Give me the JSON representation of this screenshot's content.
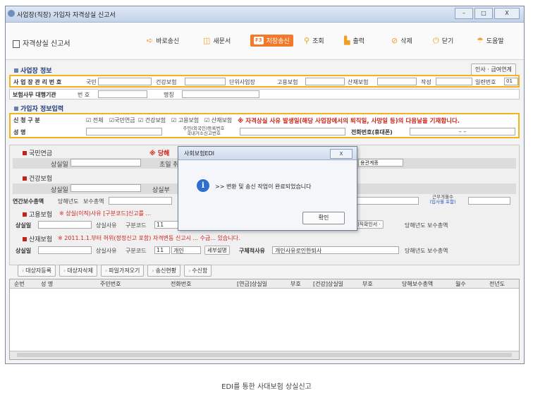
{
  "window": {
    "title": "사업장(직장) 가입자 자격상실 신고서",
    "min": "–",
    "max": "□",
    "close": "X"
  },
  "toolbar": {
    "doc_title": "자격상실 신고서",
    "buttons": [
      {
        "label": "바로송신",
        "icon": "arrow-right-icon"
      },
      {
        "label": "새문서",
        "icon": "book-icon"
      },
      {
        "label": "저장송신",
        "icon": "f3-key-icon",
        "key": "F3"
      },
      {
        "label": "조회",
        "icon": "pin-icon"
      },
      {
        "label": "출력",
        "icon": "printer-icon"
      },
      {
        "label": "삭제",
        "icon": "delete-icon"
      },
      {
        "label": "닫기",
        "icon": "power-icon"
      },
      {
        "label": "도움말",
        "icon": "help-icon"
      }
    ]
  },
  "workplace": {
    "section_title": "사업장 정보",
    "link_label": "인사 · 급여연계",
    "mgmt_no_label": "사 업 장 관 리 번 호",
    "fields": [
      "국민",
      "건강보험",
      "단위사업장",
      "고용보험",
      "산재보험",
      "작성",
      "일련번호"
    ],
    "serial_value": "01",
    "agency_label": "보험사무 대행기관",
    "num_label": "번 호",
    "name_label": "명칭"
  },
  "subscriber": {
    "section_title": "가입자 정보입력",
    "report_label": "신 청 구 분",
    "checks": [
      "전체",
      "국민연금",
      "건강보험",
      "고용보험",
      "산재보험"
    ],
    "notice": "※ 자격상실 사유 발생일(해당 사업장에서의 퇴직일, 사망일 등)의 다음날을 기재합니다.",
    "name_label": "성 명",
    "id_label_1": "주민(외국인)등록번호",
    "id_label_2": "국내거소신고번호",
    "phone_label": "전화번호(휴대폰)",
    "phone_value": "–      –"
  },
  "panel": {
    "pension": {
      "title": "국민연금",
      "warn": "※ 당해",
      "loss_date": "상실일",
      "first_payment": "초일 취"
    },
    "health": {
      "title": "건강보험",
      "loss_date": "상실일",
      "loss_reason": "상실부",
      "annual_label": "연간보수총액",
      "year_label": "당해년도",
      "total_label": "보수총액",
      "months_label_1": "근무개월수",
      "months_label_2": "(입사월 포함)",
      "relation": "용관계종"
    },
    "employment": {
      "title": "고용보험",
      "warn": "※ 상실(이직)사유 [구분코드]신고를 ...",
      "loss_date": "상실일",
      "reason_label": "상실사유",
      "code_label": "구분코드",
      "code_value": "11",
      "resign_label": "이직확인서 ·",
      "year_label": "당해년도 보수총액"
    },
    "industrial": {
      "title": "산재보험",
      "warn": "※ 2011.1.1.부터 허위(정정신고 포함) 자격변동 신고시 ... 수급... 있습니다.",
      "loss_date": "상실일",
      "reason_label": "상실사유",
      "code_label": "구분코드",
      "code_value": "11",
      "code_text": "개인",
      "detail_btn": "세부설명",
      "concrete_label": "구체적사유",
      "concrete_value": "개인사유로인한퇴사",
      "year_label": "당해년도 보수총액"
    }
  },
  "actions": [
    "대상자등록",
    "대상자삭제",
    "파일가져오기",
    "송신현황",
    "수신함"
  ],
  "grid": {
    "columns": [
      "순번",
      "성 명",
      "주민번호",
      "전화번호",
      "[연금]상실일",
      "부호",
      "[건강]상실일",
      "부호",
      "당해보수총액",
      "월수",
      "전년도"
    ]
  },
  "dialog": {
    "title": "사회보험EDI",
    "close": "X",
    "icon": "info-icon",
    "message": ">> 변환 및 송신 작업이 완료되었습니다",
    "ok_label": "확인"
  },
  "caption": "EDI를 통한 사대보험 상실신고",
  "colors": {
    "accent": "#f37a2a",
    "highlight_border": "#f0b51a",
    "warning_red": "#d0201a",
    "section_blue": "#1f3b7a"
  }
}
